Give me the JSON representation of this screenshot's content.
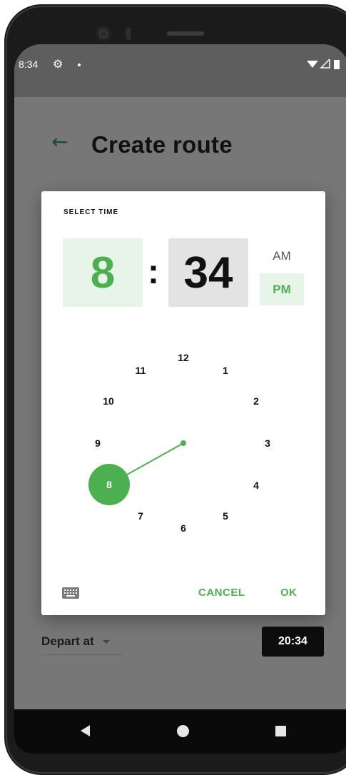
{
  "status_bar": {
    "time": "8:34"
  },
  "app_bar": {
    "title": "Create route"
  },
  "depart": {
    "label": "Depart at",
    "time_chip": "20:34"
  },
  "dialog": {
    "title": "SELECT TIME",
    "hour": "8",
    "separator": ":",
    "minute": "34",
    "am": "AM",
    "pm": "PM",
    "selected_period": "PM",
    "selected_hour": "8",
    "clock_numbers": [
      "12",
      "1",
      "2",
      "3",
      "4",
      "5",
      "6",
      "7",
      "9",
      "10",
      "11"
    ],
    "cancel_label": "CANCEL",
    "ok_label": "OK"
  },
  "colors": {
    "accent": "#4caf50",
    "accent_light": "#e7f5e8",
    "scrim": "#777777"
  }
}
